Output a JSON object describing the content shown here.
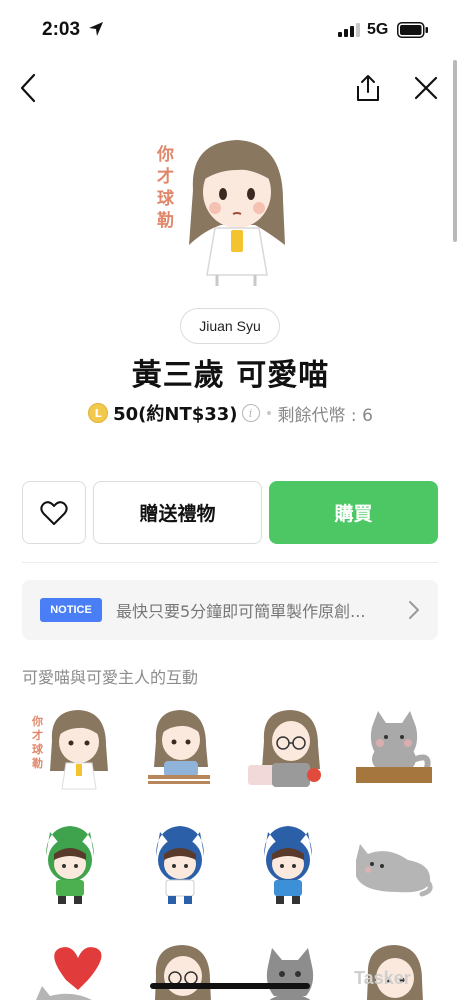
{
  "status_bar": {
    "time": "2:03",
    "network": "5G"
  },
  "nav": {
    "back_icon": "chevron-left-icon",
    "share_icon": "share-icon",
    "close_icon": "close-icon"
  },
  "product": {
    "main_sticker_text": "你才球勒",
    "author": "Jiuan Syu",
    "title": "黃三歲 可愛喵",
    "coin_letter": "L",
    "price": "50(約NT$33)",
    "info_mark": "i",
    "remaining": "剩餘代幣 : 6"
  },
  "actions": {
    "gift_label": "贈送禮物",
    "buy_label": "購買",
    "buy_color": "#4cc764"
  },
  "notice": {
    "badge": "NOTICE",
    "text": "最快只要5分鐘即可簡單製作原創...",
    "badge_color": "#4a7ef6"
  },
  "description": "可愛喵與可愛主人的互動",
  "stickers": [
    {
      "kind": "girl",
      "caption": "你才球勒"
    },
    {
      "kind": "girl-sitting"
    },
    {
      "kind": "girl-glasses"
    },
    {
      "kind": "cat-box"
    },
    {
      "kind": "child-green-hat"
    },
    {
      "kind": "child-blue-hat"
    },
    {
      "kind": "child-blue-hat-2"
    },
    {
      "kind": "cat-lying"
    },
    {
      "kind": "cat-heart"
    },
    {
      "kind": "girl-glasses-2"
    },
    {
      "kind": "cat-sitting"
    },
    {
      "kind": "girl-3"
    }
  ],
  "watermark": "Tasker"
}
